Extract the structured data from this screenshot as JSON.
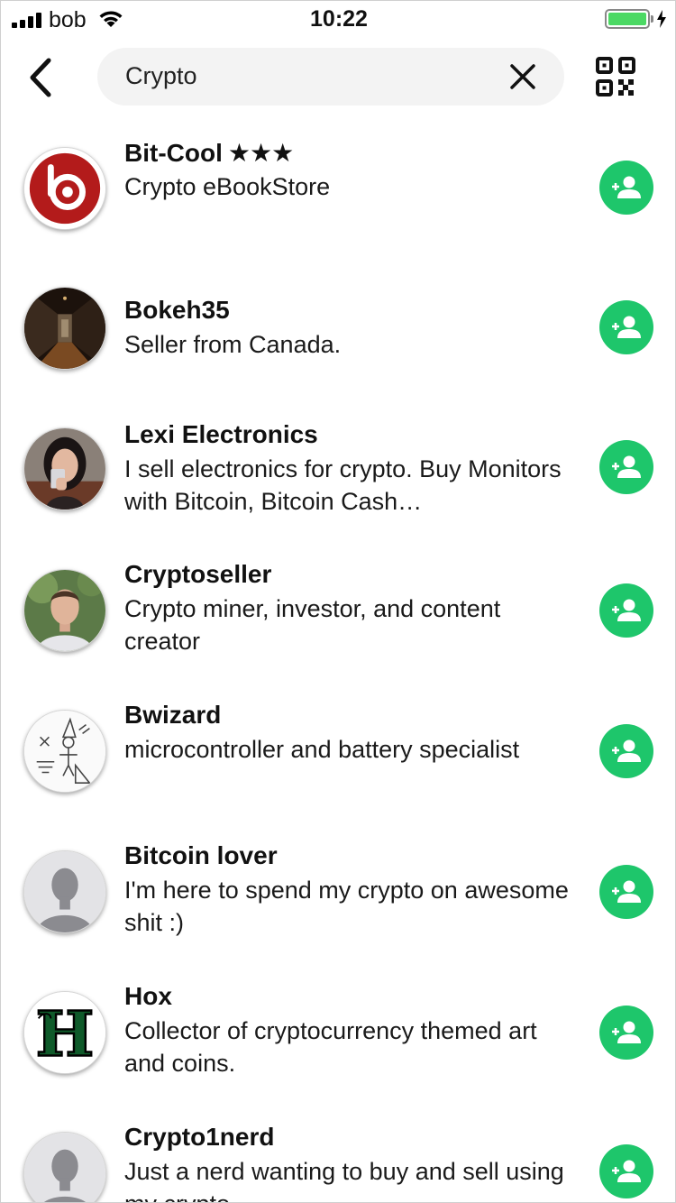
{
  "status_bar": {
    "carrier": "bob",
    "time": "10:22",
    "battery_level": 1.0,
    "battery_color": "#4cd964"
  },
  "search": {
    "query": "Crypto"
  },
  "accent_color": "#1ec66b",
  "results": [
    {
      "name": "Bit-Cool",
      "stars": "★★★",
      "description": "Crypto eBookStore",
      "avatar": "bit-cool-logo"
    },
    {
      "name": "Bokeh35",
      "stars": "",
      "description": "Seller from Canada.",
      "avatar": "hallway-photo"
    },
    {
      "name": "Lexi Electronics",
      "stars": "",
      "description": "I sell electronics for crypto. Buy Monitors with Bitcoin, Bitcoin Cash…",
      "avatar": "woman-selfie-photo"
    },
    {
      "name": "Cryptoseller",
      "stars": "",
      "description": "Crypto miner, investor, and content creator",
      "avatar": "man-portrait-photo"
    },
    {
      "name": "Bwizard",
      "stars": "",
      "description": "microcontroller and battery specialist",
      "avatar": "wizard-sketch"
    },
    {
      "name": "Bitcoin lover",
      "stars": "",
      "description": "I'm here to spend my crypto on awesome shit :)",
      "avatar": "default-user-silhouette"
    },
    {
      "name": "Hox",
      "stars": "",
      "description": "Collector of cryptocurrency themed art and coins.",
      "avatar": "gothic-h-logo"
    },
    {
      "name": "Crypto1nerd",
      "stars": "",
      "description": "Just a nerd wanting to buy and sell using my crypto",
      "avatar": "default-user-silhouette"
    }
  ]
}
